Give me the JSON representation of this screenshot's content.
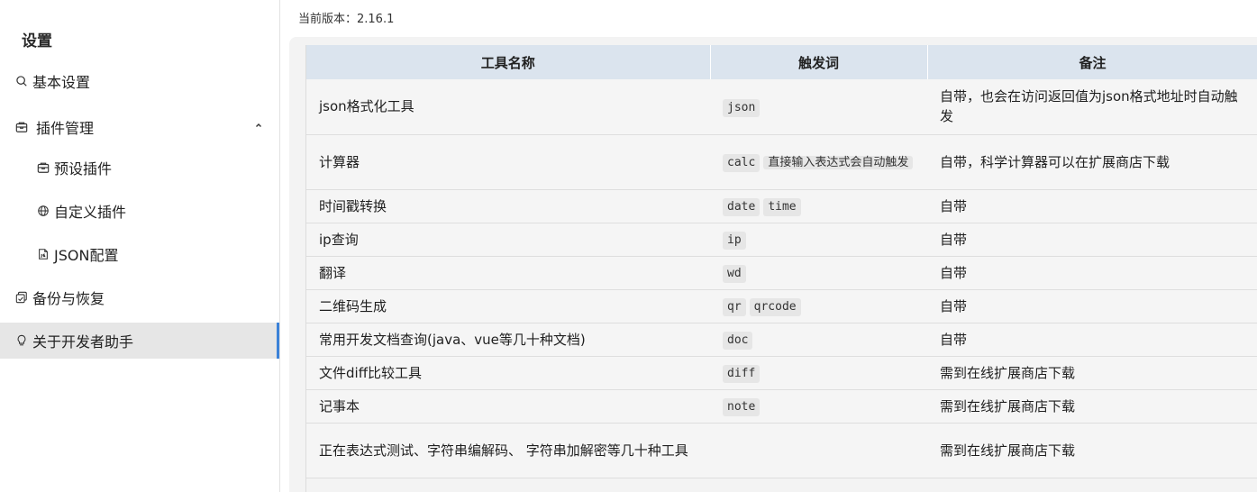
{
  "sidebar": {
    "title": "设置",
    "items": [
      {
        "label": "基本设置",
        "icon": "search-icon"
      },
      {
        "label": "插件管理",
        "icon": "plugin-box-icon"
      },
      {
        "label": "预设插件",
        "icon": "plugin-box-icon"
      },
      {
        "label": "自定义插件",
        "icon": "globe-icon"
      },
      {
        "label": "JSON配置",
        "icon": "json-file-icon"
      },
      {
        "label": "备份与恢复",
        "icon": "backup-icon"
      },
      {
        "label": "关于开发者助手",
        "icon": "lightbulb-icon"
      }
    ],
    "accent": "#3b82d8"
  },
  "main": {
    "version_text": "当前版本：2.16.1",
    "table": {
      "headers": [
        "工具名称",
        "触发词",
        "备注"
      ],
      "rows": [
        {
          "name": "json格式化工具",
          "triggers": [
            "json"
          ],
          "trigger_note": "",
          "note": "自带，也会在访问返回值为json格式地址时自动触发"
        },
        {
          "name": "计算器",
          "triggers": [
            "calc"
          ],
          "trigger_note": "直接输入表达式会自动触发",
          "note": "自带，科学计算器可以在扩展商店下载"
        },
        {
          "name": "时间戳转换",
          "triggers": [
            "date",
            "time"
          ],
          "trigger_note": "",
          "note": "自带"
        },
        {
          "name": "ip查询",
          "triggers": [
            "ip"
          ],
          "trigger_note": "",
          "note": "自带"
        },
        {
          "name": "翻译",
          "triggers": [
            "wd"
          ],
          "trigger_note": "",
          "note": "自带"
        },
        {
          "name": "二维码生成",
          "triggers": [
            "qr",
            "qrcode"
          ],
          "trigger_note": "",
          "note": "自带"
        },
        {
          "name": "常用开发文档查询(java、vue等几十种文档)",
          "triggers": [
            "doc"
          ],
          "trigger_note": "",
          "note": "自带"
        },
        {
          "name": "文件diff比较工具",
          "triggers": [
            "diff"
          ],
          "trigger_note": "",
          "note": "需到在线扩展商店下载"
        },
        {
          "name": "记事本",
          "triggers": [
            "note"
          ],
          "trigger_note": "",
          "note": "需到在线扩展商店下载"
        },
        {
          "name": "正在表达式测试、字符串编解码、 字符串加解密等几十种工具",
          "triggers": [],
          "trigger_note": "",
          "note": "需到在线扩展商店下载"
        }
      ]
    }
  }
}
